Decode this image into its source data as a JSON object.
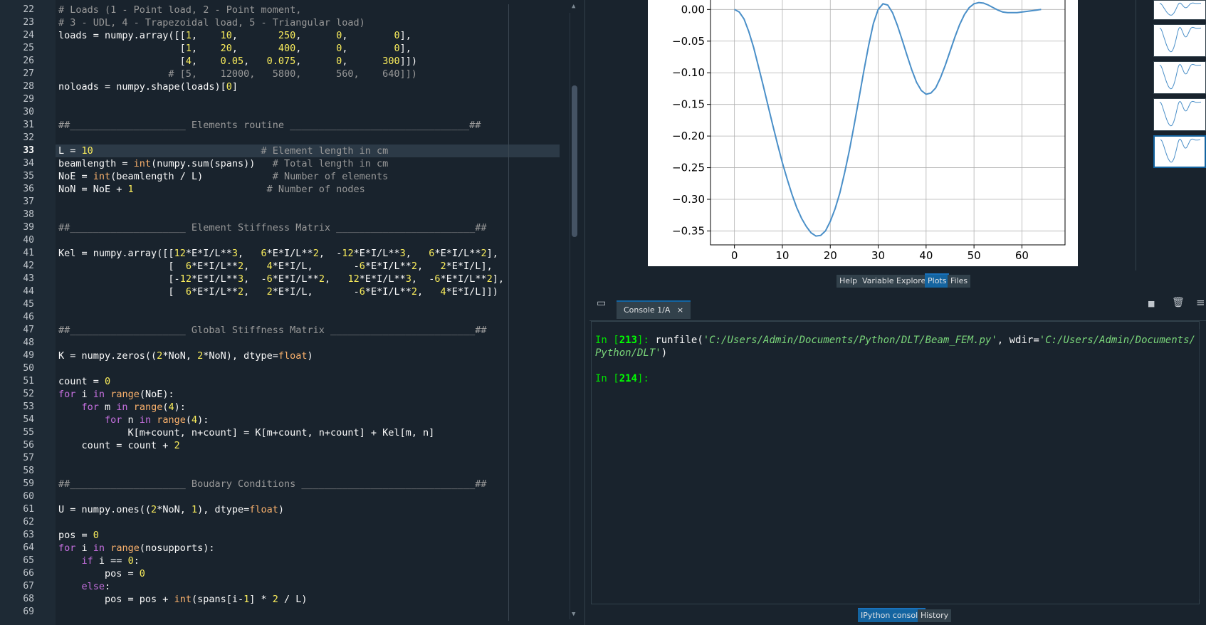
{
  "editor": {
    "current_line": "33",
    "lines": [
      {
        "n": "22",
        "html": "<span class=\"cm\"># Loads (1 - Point load, 2 - Point moment,</span>"
      },
      {
        "n": "23",
        "html": "<span class=\"cm\"># 3 - UDL, 4 - Trapezoidal load, 5 - Triangular load)</span>"
      },
      {
        "n": "24",
        "html": "loads = numpy.array([[<span class=\"num\">1</span>,    <span class=\"num\">10</span>,       <span class=\"num\">250</span>,      <span class=\"num\">0</span>,        <span class=\"num\">0</span>],"
      },
      {
        "n": "25",
        "html": "                     [<span class=\"num\">1</span>,    <span class=\"num\">20</span>,       <span class=\"num\">400</span>,      <span class=\"num\">0</span>,        <span class=\"num\">0</span>],"
      },
      {
        "n": "26",
        "html": "                     [<span class=\"num\">4</span>,    <span class=\"num\">0.05</span>,   <span class=\"num\">0.075</span>,      <span class=\"num\">0</span>,      <span class=\"num\">300</span>]])"
      },
      {
        "n": "27",
        "html": "<span class=\"cm\">                   # [5,    12000,   5800,      560,    640]])</span>"
      },
      {
        "n": "28",
        "html": "noloads = numpy.shape(loads)[<span class=\"num\">0</span>]"
      },
      {
        "n": "29",
        "html": ""
      },
      {
        "n": "30",
        "html": ""
      },
      {
        "n": "31",
        "html": "<span class=\"cm\">##____________________ Elements routine _______________________________##</span>"
      },
      {
        "n": "32",
        "html": ""
      },
      {
        "n": "33",
        "html": "L = <span class=\"num\">10</span>                             <span class=\"cm\"># Element length in cm</span>"
      },
      {
        "n": "34",
        "html": "beamlength = <span class=\"bi\">int</span>(numpy.sum(spans))   <span class=\"cm\"># Total length in cm</span>"
      },
      {
        "n": "35",
        "html": "NoE = <span class=\"bi\">int</span>(beamlength / L)            <span class=\"cm\"># Number of elements</span>"
      },
      {
        "n": "36",
        "html": "NoN = NoE + <span class=\"num\">1</span>                       <span class=\"cm\"># Number of nodes</span>"
      },
      {
        "n": "37",
        "html": ""
      },
      {
        "n": "38",
        "html": ""
      },
      {
        "n": "39",
        "html": "<span class=\"cm\">##____________________ Element Stiffness Matrix ________________________##</span>"
      },
      {
        "n": "40",
        "html": ""
      },
      {
        "n": "41",
        "html": "Kel = numpy.array([[<span class=\"num\">12</span>*E*I/L**<span class=\"num\">3</span>,   <span class=\"num\">6</span>*E*I/L**<span class=\"num\">2</span>,  -<span class=\"num\">12</span>*E*I/L**<span class=\"num\">3</span>,   <span class=\"num\">6</span>*E*I/L**<span class=\"num\">2</span>],"
      },
      {
        "n": "42",
        "html": "                   [  <span class=\"num\">6</span>*E*I/L**<span class=\"num\">2</span>,   <span class=\"num\">4</span>*E*I/L,       -<span class=\"num\">6</span>*E*I/L**<span class=\"num\">2</span>,   <span class=\"num\">2</span>*E*I/L],"
      },
      {
        "n": "43",
        "html": "                   [-<span class=\"num\">12</span>*E*I/L**<span class=\"num\">3</span>,  -<span class=\"num\">6</span>*E*I/L**<span class=\"num\">2</span>,   <span class=\"num\">12</span>*E*I/L**<span class=\"num\">3</span>,  -<span class=\"num\">6</span>*E*I/L**<span class=\"num\">2</span>],"
      },
      {
        "n": "44",
        "html": "                   [  <span class=\"num\">6</span>*E*I/L**<span class=\"num\">2</span>,   <span class=\"num\">2</span>*E*I/L,       -<span class=\"num\">6</span>*E*I/L**<span class=\"num\">2</span>,   <span class=\"num\">4</span>*E*I/L]])"
      },
      {
        "n": "45",
        "html": ""
      },
      {
        "n": "46",
        "html": ""
      },
      {
        "n": "47",
        "html": "<span class=\"cm\">##____________________ Global Stiffness Matrix _________________________##</span>"
      },
      {
        "n": "48",
        "html": ""
      },
      {
        "n": "49",
        "html": "K = numpy.zeros((<span class=\"num\">2</span>*NoN, <span class=\"num\">2</span>*NoN), dtype=<span class=\"bi\">float</span>)"
      },
      {
        "n": "50",
        "html": ""
      },
      {
        "n": "51",
        "html": "count = <span class=\"num\">0</span>"
      },
      {
        "n": "52",
        "html": "<span class=\"kw\">for</span> i <span class=\"kw\">in</span> <span class=\"bi\">range</span>(NoE):"
      },
      {
        "n": "53",
        "html": "    <span class=\"kw\">for</span> m <span class=\"kw\">in</span> <span class=\"bi\">range</span>(<span class=\"num\">4</span>):"
      },
      {
        "n": "54",
        "html": "        <span class=\"kw\">for</span> n <span class=\"kw\">in</span> <span class=\"bi\">range</span>(<span class=\"num\">4</span>):"
      },
      {
        "n": "55",
        "html": "            K[m+count, n+count] = K[m+count, n+count] + Kel[m, n]"
      },
      {
        "n": "56",
        "html": "    count = count + <span class=\"num\">2</span>"
      },
      {
        "n": "57",
        "html": ""
      },
      {
        "n": "58",
        "html": ""
      },
      {
        "n": "59",
        "html": "<span class=\"cm\">##____________________ Boudary Conditions ______________________________##</span>"
      },
      {
        "n": "60",
        "html": ""
      },
      {
        "n": "61",
        "html": "U = numpy.ones((<span class=\"num\">2</span>*NoN, <span class=\"num\">1</span>), dtype=<span class=\"bi\">float</span>)"
      },
      {
        "n": "62",
        "html": ""
      },
      {
        "n": "63",
        "html": "pos = <span class=\"num\">0</span>"
      },
      {
        "n": "64",
        "html": "<span class=\"kw\">for</span> i <span class=\"kw\">in</span> <span class=\"bi\">range</span>(nosupports):"
      },
      {
        "n": "65",
        "html": "    <span class=\"kw\">if</span> i == <span class=\"num\">0</span>:"
      },
      {
        "n": "66",
        "html": "        pos = <span class=\"num\">0</span>"
      },
      {
        "n": "67",
        "html": "    <span class=\"kw\">else</span>:"
      },
      {
        "n": "68",
        "html": "        pos = pos + <span class=\"bi\">int</span>(spans[i-<span class=\"num\">1</span>] * <span class=\"num\">2</span> / L)"
      },
      {
        "n": "69",
        "html": ""
      }
    ]
  },
  "plot_tabs": [
    "Help",
    "Variable Explorer",
    "Plots",
    "Files"
  ],
  "plot_active_tab": "Plots",
  "console": {
    "tab_label": "Console 1/A",
    "close_glyph": "×",
    "in1_prompt": "In [",
    "in1_num": "213",
    "in1_close": "]: ",
    "in1_code_a": "runfile(",
    "in1_str_a": "'C:/Users/Admin/Documents/Python/DLT/Beam_FEM.py'",
    "in1_code_b": ", wdir=",
    "in1_str_b1": "'C:/Users/Admin/Documents/",
    "in1_str_b2": "Python/DLT'",
    "in1_end": ")",
    "in2_prompt": "In [",
    "in2_num": "214",
    "in2_close": "]:"
  },
  "console_tabs": [
    "IPython console",
    "History"
  ],
  "console_active_tab": "IPython console",
  "chart_data": {
    "type": "line",
    "x": [
      0,
      1,
      2,
      3,
      4,
      5,
      6,
      7,
      8,
      9,
      10,
      11,
      12,
      13,
      14,
      15,
      16,
      17,
      18,
      19,
      20,
      21,
      22,
      23,
      24,
      25,
      26,
      27,
      28,
      29,
      30,
      31,
      32,
      33,
      34,
      35,
      36,
      37,
      38,
      39,
      40,
      41,
      42,
      43,
      44,
      45,
      46,
      47,
      48,
      49,
      50,
      51,
      52,
      53,
      54,
      55,
      56,
      57,
      58,
      59,
      60,
      61,
      62,
      63,
      64
    ],
    "values": [
      0,
      -0.004,
      -0.015,
      -0.035,
      -0.06,
      -0.09,
      -0.12,
      -0.152,
      -0.183,
      -0.213,
      -0.242,
      -0.268,
      -0.292,
      -0.313,
      -0.33,
      -0.343,
      -0.353,
      -0.358,
      -0.357,
      -0.35,
      -0.335,
      -0.315,
      -0.29,
      -0.258,
      -0.222,
      -0.182,
      -0.14,
      -0.097,
      -0.057,
      -0.022,
      0.0,
      0.009,
      0.007,
      -0.005,
      -0.025,
      -0.048,
      -0.072,
      -0.095,
      -0.115,
      -0.128,
      -0.134,
      -0.132,
      -0.124,
      -0.108,
      -0.088,
      -0.066,
      -0.044,
      -0.024,
      -0.008,
      0.003,
      0.009,
      0.011,
      0.01,
      0.007,
      0.003,
      -0.001,
      -0.004,
      -0.005,
      -0.005,
      -0.005,
      -0.004,
      -0.003,
      -0.002,
      -0.001,
      0.0
    ],
    "xlim": [
      -5,
      69
    ],
    "ylim": [
      -0.372,
      0.015
    ],
    "xticks": [
      "0",
      "10",
      "20",
      "30",
      "40",
      "50",
      "60"
    ],
    "yticks": [
      "0.00",
      "−0.05",
      "−0.10",
      "−0.15",
      "−0.20",
      "−0.25",
      "−0.30",
      "−0.35"
    ],
    "grid": true,
    "line_color": "#4a8fc8"
  }
}
